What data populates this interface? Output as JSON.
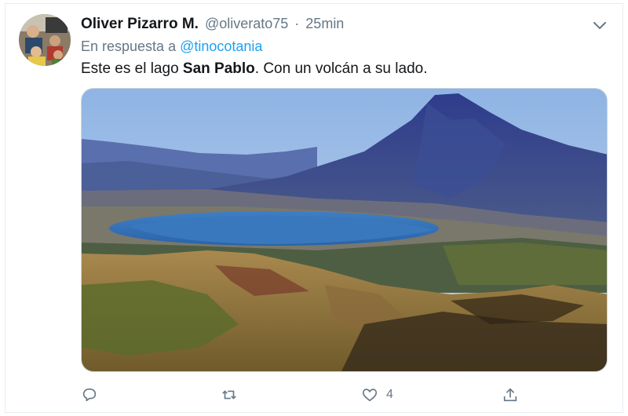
{
  "tweet": {
    "author_name": "Oliver Pizarro M.",
    "handle": "@oliverato75",
    "separator": "·",
    "time": "25min",
    "reply_prefix": "En respuesta a",
    "reply_to": "@tinocotania",
    "text_before": "Este es el lago ",
    "text_bold": "San Pablo",
    "text_after": ". Con un volcán a su lado.",
    "like_count": "4"
  },
  "icons": [
    "chevron-down-icon",
    "reply-icon",
    "retweet-icon",
    "like-icon",
    "share-icon"
  ],
  "colors": {
    "link": "#1da1f2",
    "secondary_text": "#657786",
    "icon": "#657786"
  }
}
